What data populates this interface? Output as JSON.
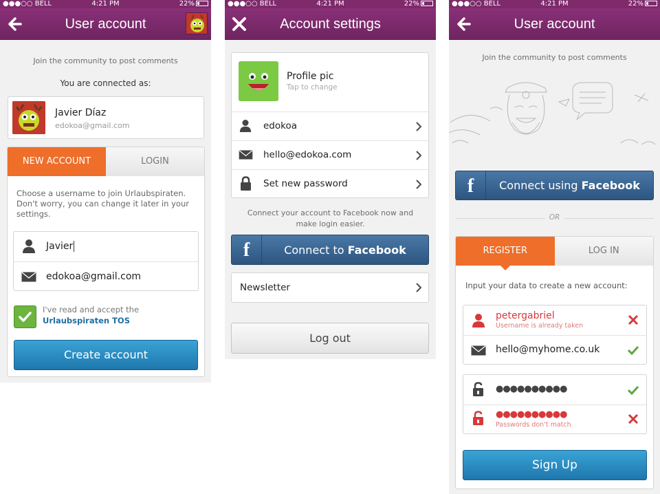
{
  "status_bar": {
    "carrier": "●●●○○ BELL",
    "time": "4:21 PM",
    "battery": "22%"
  },
  "screen1": {
    "title": "User account",
    "intro": "Join the community to post comments",
    "connected_as": "You are connected as:",
    "user_name": "Javier Díaz",
    "user_email": "edokoa@gmail.com",
    "tab_new_account": "NEW ACCOUNT",
    "tab_login": "LOGIN",
    "help_text": "Choose a username to join Urlaubspiraten. Don't worry, you can change it later in your settings.",
    "username_value": "Javier",
    "email_value": "edokoa@gmail.com",
    "tos_text": "I've read and accept  the",
    "tos_link": "Urlaubspiraten TOS",
    "create_button": "Create account"
  },
  "screen2": {
    "title": "Account settings",
    "profile_pic_label": "Profile pic",
    "profile_pic_hint": "Tap to change",
    "username": "edokoa",
    "email": "hello@edokoa.com",
    "password_label": "Set new password",
    "facebook_hint": "Connect your account to Facebook now and make login easier.",
    "facebook_button_prefix": "Connect to ",
    "facebook_button_brand": "Facebook",
    "newsletter_label": "Newsletter",
    "logout_button": "Log out"
  },
  "screen3": {
    "title": "User account",
    "intro": "Join the community to post comments",
    "facebook_button_prefix": "Connect using ",
    "facebook_button_brand": "Facebook",
    "or_label": "OR",
    "tab_register": "REGISTER",
    "tab_login": "LOG IN",
    "help_text": "Input your data to create a new account:",
    "username_value": "petergabriel",
    "username_error": "Username is already taken",
    "email_value": "hello@myhome.co.uk",
    "password_dots": "●●●●●●●●●●",
    "password_confirm_dots": "●●●●●●●●●●",
    "password_error": "Passwords don't match",
    "signup_button": "Sign Up"
  },
  "colors": {
    "brand_purple": "#7e2a6b",
    "accent_orange": "#ee6e2a",
    "action_blue": "#1e77ad",
    "facebook_blue": "#2d5580",
    "error_red": "#d9383a",
    "success_green": "#5aab3a"
  },
  "icons": [
    "back-arrow-icon",
    "close-icon",
    "user-icon",
    "envelope-icon",
    "lock-icon",
    "unlock-icon",
    "chevron-right-icon",
    "checkmark-icon",
    "cross-icon",
    "facebook-icon"
  ]
}
